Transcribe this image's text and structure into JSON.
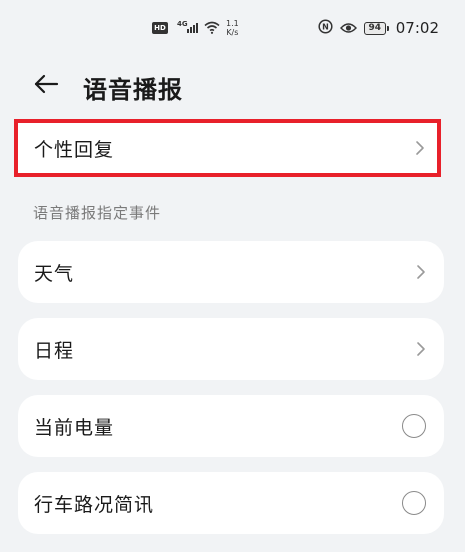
{
  "status_bar": {
    "hd": "HD",
    "network": "4G",
    "speed_value": "1.1",
    "speed_unit": "K/s",
    "battery": "94",
    "time": "07:02",
    "icons": [
      "hd-icon",
      "signal-icon",
      "wifi-icon",
      "nfc-icon",
      "eye-icon",
      "battery-icon"
    ]
  },
  "header": {
    "back_icon": "arrow-left-icon",
    "title": "语音播报"
  },
  "personal_reply": {
    "label": "个性回复",
    "highlight_color": "#e8202a"
  },
  "section": {
    "label": "语音播报指定事件"
  },
  "items": [
    {
      "label": "天气",
      "control": "chevron"
    },
    {
      "label": "日程",
      "control": "chevron"
    },
    {
      "label": "当前电量",
      "control": "radio",
      "checked": false
    },
    {
      "label": "行车路况简讯",
      "control": "radio",
      "checked": false
    }
  ]
}
